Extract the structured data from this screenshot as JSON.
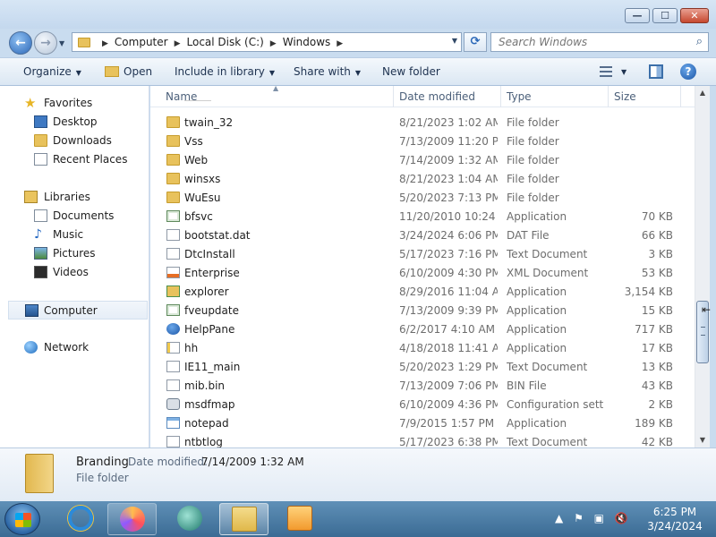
{
  "window": {
    "caption_buttons": {
      "minimize": "—",
      "maximize": "☐",
      "close": "✕"
    }
  },
  "address": {
    "breadcrumbs": [
      "Computer",
      "Local Disk (C:)",
      "Windows"
    ],
    "search_placeholder": "Search Windows"
  },
  "toolbar": {
    "organize": "Organize",
    "open": "Open",
    "include_in_library": "Include in library",
    "share_with": "Share with",
    "new_folder": "New folder"
  },
  "sidebar": {
    "favorites": {
      "label": "Favorites",
      "items": [
        "Desktop",
        "Downloads",
        "Recent Places"
      ]
    },
    "libraries": {
      "label": "Libraries",
      "items": [
        "Documents",
        "Music",
        "Pictures",
        "Videos"
      ]
    },
    "computer": "Computer",
    "network": "Network"
  },
  "columns": {
    "name": "Name",
    "date_modified": "Date modified",
    "type": "Type",
    "size": "Size"
  },
  "files": [
    {
      "name": "twain_32",
      "date": "8/21/2023 1:02 AM",
      "type": "File folder",
      "size": "",
      "icon": "folder-icon"
    },
    {
      "name": "Vss",
      "date": "7/13/2009 11:20 PM",
      "type": "File folder",
      "size": "",
      "icon": "folder-icon"
    },
    {
      "name": "Web",
      "date": "7/14/2009 1:32 AM",
      "type": "File folder",
      "size": "",
      "icon": "folder-icon"
    },
    {
      "name": "winsxs",
      "date": "8/21/2023 1:04 AM",
      "type": "File folder",
      "size": "",
      "icon": "folder-icon"
    },
    {
      "name": "WuEsu",
      "date": "5/20/2023 7:13 PM",
      "type": "File folder",
      "size": "",
      "icon": "folder-icon"
    },
    {
      "name": "bfsvc",
      "date": "11/20/2010 10:24 ...",
      "type": "Application",
      "size": "70 KB",
      "icon": "application-icon"
    },
    {
      "name": "bootstat.dat",
      "date": "3/24/2024 6:06 PM",
      "type": "DAT File",
      "size": "66 KB",
      "icon": "document-icon"
    },
    {
      "name": "DtcInstall",
      "date": "5/17/2023 7:16 PM",
      "type": "Text Document",
      "size": "3 KB",
      "icon": "document-icon"
    },
    {
      "name": "Enterprise",
      "date": "6/10/2009 4:30 PM",
      "type": "XML Document",
      "size": "53 KB",
      "icon": "xml-icon"
    },
    {
      "name": "explorer",
      "date": "8/29/2016 11:04 AM",
      "type": "Application",
      "size": "3,154 KB",
      "icon": "explorer-icon"
    },
    {
      "name": "fveupdate",
      "date": "7/13/2009 9:39 PM",
      "type": "Application",
      "size": "15 KB",
      "icon": "application-icon"
    },
    {
      "name": "HelpPane",
      "date": "6/2/2017 4:10 AM",
      "type": "Application",
      "size": "717 KB",
      "icon": "help-icon"
    },
    {
      "name": "hh",
      "date": "4/18/2018 11:41 AM",
      "type": "Application",
      "size": "17 KB",
      "icon": "hh-icon"
    },
    {
      "name": "IE11_main",
      "date": "5/20/2023 1:29 PM",
      "type": "Text Document",
      "size": "13 KB",
      "icon": "document-icon"
    },
    {
      "name": "mib.bin",
      "date": "7/13/2009 7:06 PM",
      "type": "BIN File",
      "size": "43 KB",
      "icon": "document-icon"
    },
    {
      "name": "msdfmap",
      "date": "6/10/2009 4:36 PM",
      "type": "Configuration sett...",
      "size": "2 KB",
      "icon": "settings-icon"
    },
    {
      "name": "notepad",
      "date": "7/9/2015 1:57 PM",
      "type": "Application",
      "size": "189 KB",
      "icon": "notepad-icon"
    },
    {
      "name": "ntbtlog",
      "date": "5/17/2023 6:38 PM",
      "type": "Text Document",
      "size": "42 KB",
      "icon": "document-icon"
    }
  ],
  "details": {
    "name": "Branding",
    "modified_label": "Date modified:",
    "modified_value": "7/14/2009 1:32 AM",
    "type": "File folder"
  },
  "taskbar": {
    "apps": [
      "Internet Explorer",
      "Firefox",
      "App",
      "Windows Explorer",
      "Media Player"
    ],
    "time": "6:25 PM",
    "date": "3/24/2024"
  }
}
